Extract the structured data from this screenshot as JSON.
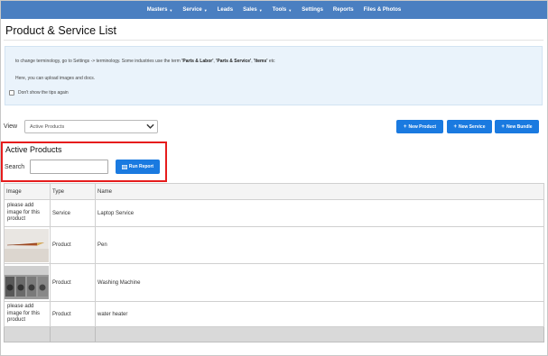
{
  "nav": {
    "items": [
      {
        "label": "Masters",
        "caret": true
      },
      {
        "label": "Service",
        "caret": true
      },
      {
        "label": "Leads",
        "caret": false
      },
      {
        "label": "Sales",
        "caret": true
      },
      {
        "label": "Tools",
        "caret": true
      },
      {
        "label": "Settings",
        "caret": false
      },
      {
        "label": "Reports",
        "caret": false
      },
      {
        "label": "Files & Photos",
        "caret": false
      }
    ]
  },
  "page": {
    "title": "Product & Service List"
  },
  "tips": {
    "line1_prefix": "to change terminology, go to Settings -> terminology. Some industries use the term ",
    "term1": "'Parts & Labor'",
    "sep1": ", ",
    "term2": "'Parts & Service'",
    "sep2": ", ",
    "term3": "'Items'",
    "line1_suffix": " etc",
    "line2": "Here, you can upload images and docs.",
    "checkbox_label": "Don't show the tips again"
  },
  "view": {
    "label": "View",
    "selected": "Active Products"
  },
  "buttons": {
    "new_product": "New Product",
    "new_service": "New Service",
    "new_bundle": "New Bundle",
    "run_report": "Run Report"
  },
  "section": {
    "title": "Active Products",
    "search_label": "Search",
    "search_value": ""
  },
  "table": {
    "headers": [
      "Image",
      "Type",
      "Name"
    ],
    "rows": [
      {
        "image": "please add image for this product",
        "type": "Service",
        "name": "Laptop Service"
      },
      {
        "image": "",
        "type": "Product",
        "name": "Pen"
      },
      {
        "image": "",
        "type": "Product",
        "name": "Washing Machine"
      },
      {
        "image": "please add image for this product",
        "type": "Product",
        "name": "water heater"
      }
    ]
  },
  "colors": {
    "nav": "#4a7fc1",
    "accent": "#1a7ae0",
    "highlight": "#e61c1c",
    "tips_bg": "#eaf3fb"
  }
}
